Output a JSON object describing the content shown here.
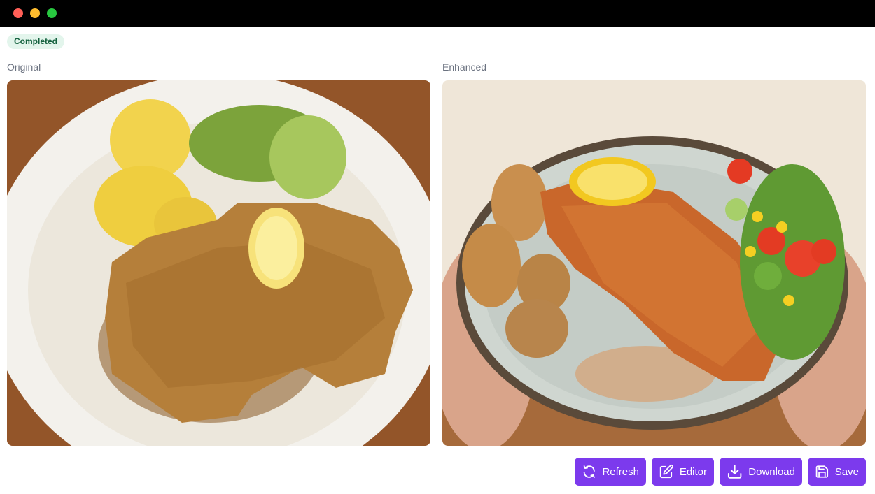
{
  "status": {
    "label": "Completed",
    "color": "#15623f",
    "background": "#e3f5ec"
  },
  "panels": {
    "original": {
      "label": "Original"
    },
    "enhanced": {
      "label": "Enhanced"
    }
  },
  "actions": {
    "refresh": {
      "label": "Refresh",
      "icon": "refresh-icon"
    },
    "editor": {
      "label": "Editor",
      "icon": "edit-icon"
    },
    "download": {
      "label": "Download",
      "icon": "download-icon"
    },
    "save": {
      "label": "Save",
      "icon": "save-icon"
    }
  },
  "accent_color": "#7c3aed"
}
